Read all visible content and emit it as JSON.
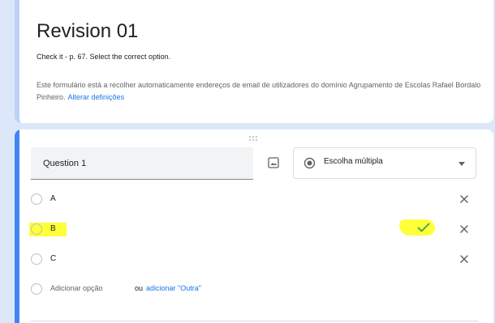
{
  "header": {
    "title": "Revision 01",
    "description": "Check it - p. 67. Select the correct option.",
    "notice": "Este formulário está a recolher automaticamente endereços de email de utilizadores do domínio Agrupamento de Escolas Rafael Bordalo Pinheiro.",
    "notice_link": "Alterar definições"
  },
  "question": {
    "title": "Question 1",
    "type_label": "Escolha múltipla",
    "options": [
      {
        "label": "A",
        "highlighted": false,
        "marked_correct": false
      },
      {
        "label": "B",
        "highlighted": true,
        "marked_correct": true
      },
      {
        "label": "C",
        "highlighted": false,
        "marked_correct": false
      }
    ],
    "add_option_label": "Adicionar opção",
    "or_label": "ou",
    "add_other_label": "adicionar \"Outra\""
  },
  "colors": {
    "accent": "#4285f4",
    "link": "#1a73e8",
    "correct": "#34a853",
    "highlight": "#ffff3a",
    "background": "#dce8fa"
  },
  "icons": {
    "drag": "drag-handle-icon",
    "image": "image-icon",
    "type": "radio-button-checked-icon",
    "dropdown": "caret-down-icon",
    "remove": "close-icon",
    "correct": "checkmark-icon"
  }
}
